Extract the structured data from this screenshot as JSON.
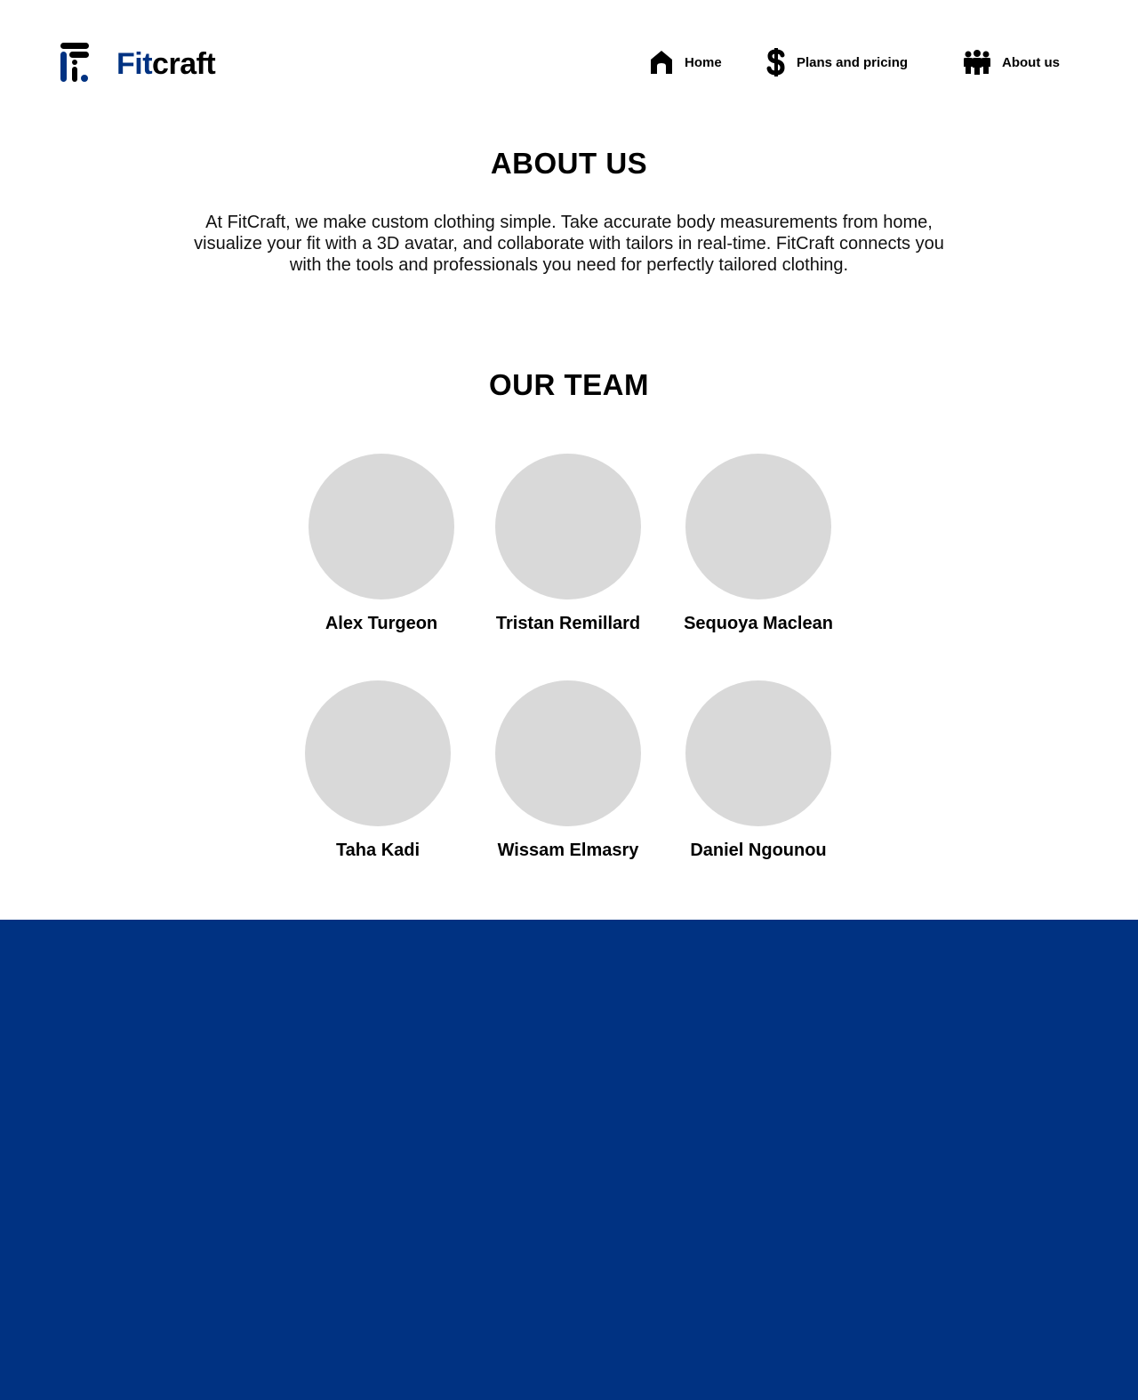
{
  "brand": {
    "name_part1": "Fit",
    "name_part2": "craft",
    "accent": "#003282"
  },
  "nav": {
    "items": [
      {
        "label": "Home",
        "icon": "home-icon"
      },
      {
        "label": "Plans and pricing",
        "icon": "dollar-icon"
      },
      {
        "label": "About us",
        "icon": "people-icon"
      }
    ]
  },
  "about": {
    "title": "ABOUT US",
    "text": "At FitCraft, we make custom clothing simple. Take accurate body measurements from home, visualize your fit with a 3D avatar, and collaborate with tailors in real-time. FitCraft connects you with the tools and professionals you need for perfectly tailored clothing."
  },
  "team": {
    "title": "OUR TEAM",
    "members": [
      {
        "name": "Alex Turgeon"
      },
      {
        "name": "Tristan Remillard"
      },
      {
        "name": "Sequoya Maclean"
      },
      {
        "name": "Taha Kadi"
      },
      {
        "name": "Wissam Elmasry"
      },
      {
        "name": "Daniel Ngounou"
      }
    ]
  },
  "colors": {
    "avatar_placeholder": "#d9d9d9",
    "footer": "#003282"
  }
}
